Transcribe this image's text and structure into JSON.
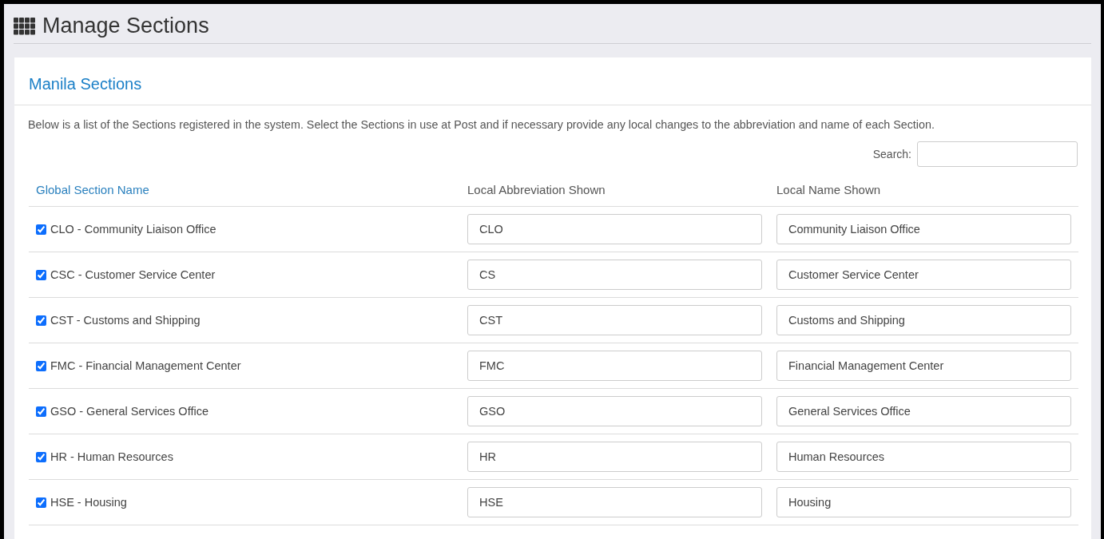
{
  "page_title": "Manage Sections",
  "card": {
    "title": "Manila Sections",
    "description": "Below is a list of the Sections registered in the system. Select the Sections in use at Post and if necessary provide any local changes to the abbreviation and name of each Section.",
    "search": {
      "label": "Search:"
    },
    "table": {
      "columns": [
        {
          "label": "Global Section Name",
          "sortable": true
        },
        {
          "label": "Local Abbreviation Shown",
          "sortable": false
        },
        {
          "label": "Local Name Shown",
          "sortable": false
        }
      ],
      "rows": [
        {
          "checked": true,
          "global_name": "CLO - Community Liaison Office",
          "abbreviation": "CLO",
          "local_name": "Community Liaison Office"
        },
        {
          "checked": true,
          "global_name": "CSC - Customer Service Center",
          "abbreviation": "CS",
          "local_name": "Customer Service Center"
        },
        {
          "checked": true,
          "global_name": "CST - Customs and Shipping",
          "abbreviation": "CST",
          "local_name": "Customs and Shipping"
        },
        {
          "checked": true,
          "global_name": "FMC - Financial Management Center",
          "abbreviation": "FMC",
          "local_name": "Financial Management Center"
        },
        {
          "checked": true,
          "global_name": "GSO - General Services Office",
          "abbreviation": "GSO",
          "local_name": "General Services Office"
        },
        {
          "checked": true,
          "global_name": "HR - Human Resources",
          "abbreviation": "HR",
          "local_name": "Human Resources"
        },
        {
          "checked": true,
          "global_name": "HSE - Housing",
          "abbreviation": "HSE",
          "local_name": "Housing"
        }
      ]
    }
  }
}
